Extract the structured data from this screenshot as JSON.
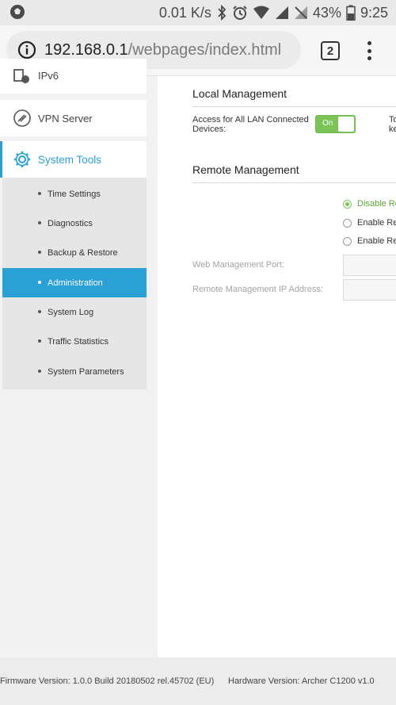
{
  "status_bar": {
    "network_speed": "0.01 K/s",
    "battery_percent": "43%",
    "time": "9:25",
    "icons": [
      "app-badge-icon",
      "bluetooth-icon",
      "alarm-icon",
      "wifi-icon",
      "signal-icon",
      "no-sim-icon",
      "battery-icon"
    ]
  },
  "browser": {
    "url_host": "192.168.0.1",
    "url_path": "/webpages/index.html",
    "tab_count": "2"
  },
  "sidebar": {
    "items": [
      {
        "label": "IPv6",
        "icon": "ipv6-icon"
      },
      {
        "label": "VPN Server",
        "icon": "vpn-icon"
      },
      {
        "label": "System Tools",
        "icon": "gear-icon",
        "active": true
      }
    ],
    "submenu": [
      {
        "label": "Time Settings"
      },
      {
        "label": "Diagnostics"
      },
      {
        "label": "Backup & Restore"
      },
      {
        "label": "Administration",
        "selected": true
      },
      {
        "label": "System Log"
      },
      {
        "label": "Traffic Statistics"
      },
      {
        "label": "System Parameters"
      }
    ]
  },
  "local_management": {
    "title": "Local Management",
    "access_label": "Access for All LAN Connected Devices:",
    "toggle_value": "On",
    "right_cut_line1": "To",
    "right_cut_line2": "ke"
  },
  "remote_management": {
    "title": "Remote Management",
    "options": [
      {
        "label": "Disable Re",
        "checked": true
      },
      {
        "label": "Enable Rer",
        "checked": false
      },
      {
        "label": "Enable Rer",
        "checked": false
      }
    ],
    "port_label": "Web Management Port:",
    "ip_label": "Remote Management IP Address:"
  },
  "footer": {
    "firmware": "Firmware Version: 1.0.0 Build 20180502 rel.45702 (EU)",
    "hardware": "Hardware Version: Archer C1200 v1.0"
  },
  "colors": {
    "accent": "#2aa0d4",
    "toggle_on": "#7cc35a",
    "sidebar_bg": "#f2f2f2"
  }
}
